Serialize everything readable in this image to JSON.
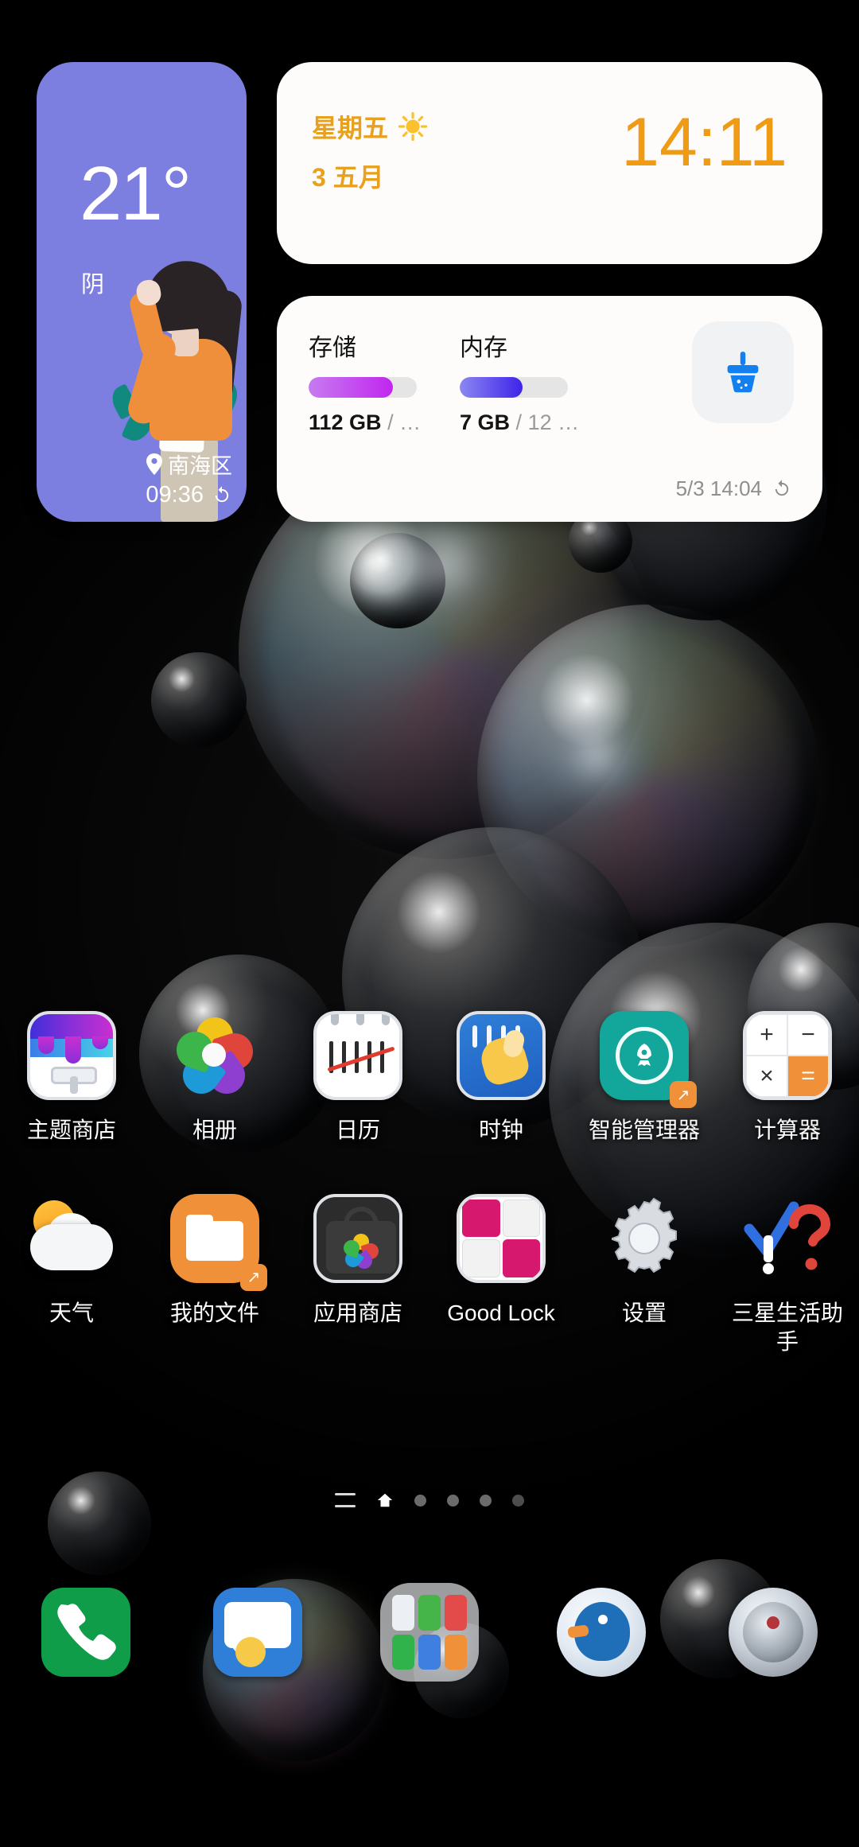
{
  "weather_widget": {
    "temperature": "21°",
    "condition": "阴",
    "location": "南海区",
    "updated_time": "09:36",
    "refresh_icon": "refresh-icon",
    "pin_icon": "location-pin-icon",
    "background_color": "#7d7fe0"
  },
  "clock_widget": {
    "day_of_week": "星期五",
    "weather_icon": "sun-icon",
    "date": "3 五月",
    "time": "14:11",
    "accent_color": "#ef9b14"
  },
  "storage_widget": {
    "storage": {
      "label": "存储",
      "value": "112 GB",
      "separator": "/",
      "total": "…",
      "percent": 78,
      "color": "#c126ee"
    },
    "memory": {
      "label": "内存",
      "value": "7 GB",
      "separator": "/",
      "total": "12 …",
      "percent": 58,
      "color": "#3f23e8"
    },
    "clean_button_icon": "broom-clean-icon",
    "timestamp": "5/3 14:04",
    "refresh_icon": "refresh-icon"
  },
  "app_grid": {
    "rows": [
      [
        {
          "label": "主题商店",
          "icon": "theme-store-icon"
        },
        {
          "label": "相册",
          "icon": "gallery-icon"
        },
        {
          "label": "日历",
          "icon": "calendar-icon"
        },
        {
          "label": "时钟",
          "icon": "clock-icon"
        },
        {
          "label": "智能管理器",
          "icon": "smart-manager-icon"
        },
        {
          "label": "计算器",
          "icon": "calculator-icon"
        }
      ],
      [
        {
          "label": "天气",
          "icon": "weather-icon"
        },
        {
          "label": "我的文件",
          "icon": "my-files-icon"
        },
        {
          "label": "应用商店",
          "icon": "app-store-icon"
        },
        {
          "label": "Good Lock",
          "icon": "good-lock-icon"
        },
        {
          "label": "设置",
          "icon": "settings-gear-icon"
        },
        {
          "label": "三星生活助手",
          "icon": "samsung-life-assistant-icon"
        }
      ]
    ]
  },
  "calculator_keys": [
    "+",
    "−",
    "×",
    "="
  ],
  "page_indicator": {
    "menu_icon": "app-list-icon",
    "home_icon": "home-page-icon",
    "dots": 4,
    "active_index": 0
  },
  "dock": [
    {
      "label": "电话",
      "icon": "phone-icon"
    },
    {
      "label": "信息",
      "icon": "messages-icon"
    },
    {
      "label": "文件夹",
      "icon": "app-folder-icon"
    },
    {
      "label": "浏览器",
      "icon": "browser-icon"
    },
    {
      "label": "相机",
      "icon": "camera-icon"
    }
  ]
}
